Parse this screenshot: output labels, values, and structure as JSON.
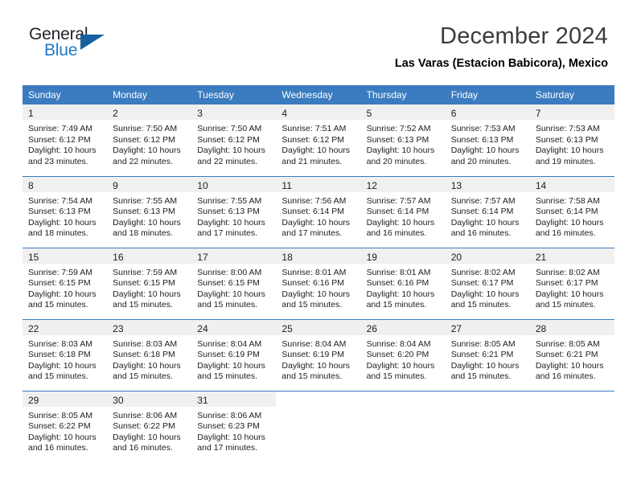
{
  "brand": {
    "name_top": "General",
    "name_bottom": "Blue",
    "triangle_color": "#17609f",
    "blue_color": "#1f7ac4"
  },
  "header": {
    "month_title": "December 2024",
    "location": "Las Varas (Estacion Babicora), Mexico"
  },
  "theme": {
    "header_blue": "#3a7cbf",
    "daynum_bg": "#f0f0f0",
    "text": "#1d1d1d"
  },
  "weekday_headers": [
    "Sunday",
    "Monday",
    "Tuesday",
    "Wednesday",
    "Thursday",
    "Friday",
    "Saturday"
  ],
  "weeks": [
    [
      {
        "day": "1",
        "details": "Sunrise: 7:49 AM\nSunset: 6:12 PM\nDaylight: 10 hours\nand 23 minutes."
      },
      {
        "day": "2",
        "details": "Sunrise: 7:50 AM\nSunset: 6:12 PM\nDaylight: 10 hours\nand 22 minutes."
      },
      {
        "day": "3",
        "details": "Sunrise: 7:50 AM\nSunset: 6:12 PM\nDaylight: 10 hours\nand 22 minutes."
      },
      {
        "day": "4",
        "details": "Sunrise: 7:51 AM\nSunset: 6:12 PM\nDaylight: 10 hours\nand 21 minutes."
      },
      {
        "day": "5",
        "details": "Sunrise: 7:52 AM\nSunset: 6:13 PM\nDaylight: 10 hours\nand 20 minutes."
      },
      {
        "day": "6",
        "details": "Sunrise: 7:53 AM\nSunset: 6:13 PM\nDaylight: 10 hours\nand 20 minutes."
      },
      {
        "day": "7",
        "details": "Sunrise: 7:53 AM\nSunset: 6:13 PM\nDaylight: 10 hours\nand 19 minutes."
      }
    ],
    [
      {
        "day": "8",
        "details": "Sunrise: 7:54 AM\nSunset: 6:13 PM\nDaylight: 10 hours\nand 18 minutes."
      },
      {
        "day": "9",
        "details": "Sunrise: 7:55 AM\nSunset: 6:13 PM\nDaylight: 10 hours\nand 18 minutes."
      },
      {
        "day": "10",
        "details": "Sunrise: 7:55 AM\nSunset: 6:13 PM\nDaylight: 10 hours\nand 17 minutes."
      },
      {
        "day": "11",
        "details": "Sunrise: 7:56 AM\nSunset: 6:14 PM\nDaylight: 10 hours\nand 17 minutes."
      },
      {
        "day": "12",
        "details": "Sunrise: 7:57 AM\nSunset: 6:14 PM\nDaylight: 10 hours\nand 16 minutes."
      },
      {
        "day": "13",
        "details": "Sunrise: 7:57 AM\nSunset: 6:14 PM\nDaylight: 10 hours\nand 16 minutes."
      },
      {
        "day": "14",
        "details": "Sunrise: 7:58 AM\nSunset: 6:14 PM\nDaylight: 10 hours\nand 16 minutes."
      }
    ],
    [
      {
        "day": "15",
        "details": "Sunrise: 7:59 AM\nSunset: 6:15 PM\nDaylight: 10 hours\nand 15 minutes."
      },
      {
        "day": "16",
        "details": "Sunrise: 7:59 AM\nSunset: 6:15 PM\nDaylight: 10 hours\nand 15 minutes."
      },
      {
        "day": "17",
        "details": "Sunrise: 8:00 AM\nSunset: 6:15 PM\nDaylight: 10 hours\nand 15 minutes."
      },
      {
        "day": "18",
        "details": "Sunrise: 8:01 AM\nSunset: 6:16 PM\nDaylight: 10 hours\nand 15 minutes."
      },
      {
        "day": "19",
        "details": "Sunrise: 8:01 AM\nSunset: 6:16 PM\nDaylight: 10 hours\nand 15 minutes."
      },
      {
        "day": "20",
        "details": "Sunrise: 8:02 AM\nSunset: 6:17 PM\nDaylight: 10 hours\nand 15 minutes."
      },
      {
        "day": "21",
        "details": "Sunrise: 8:02 AM\nSunset: 6:17 PM\nDaylight: 10 hours\nand 15 minutes."
      }
    ],
    [
      {
        "day": "22",
        "details": "Sunrise: 8:03 AM\nSunset: 6:18 PM\nDaylight: 10 hours\nand 15 minutes."
      },
      {
        "day": "23",
        "details": "Sunrise: 8:03 AM\nSunset: 6:18 PM\nDaylight: 10 hours\nand 15 minutes."
      },
      {
        "day": "24",
        "details": "Sunrise: 8:04 AM\nSunset: 6:19 PM\nDaylight: 10 hours\nand 15 minutes."
      },
      {
        "day": "25",
        "details": "Sunrise: 8:04 AM\nSunset: 6:19 PM\nDaylight: 10 hours\nand 15 minutes."
      },
      {
        "day": "26",
        "details": "Sunrise: 8:04 AM\nSunset: 6:20 PM\nDaylight: 10 hours\nand 15 minutes."
      },
      {
        "day": "27",
        "details": "Sunrise: 8:05 AM\nSunset: 6:21 PM\nDaylight: 10 hours\nand 15 minutes."
      },
      {
        "day": "28",
        "details": "Sunrise: 8:05 AM\nSunset: 6:21 PM\nDaylight: 10 hours\nand 16 minutes."
      }
    ],
    [
      {
        "day": "29",
        "details": "Sunrise: 8:05 AM\nSunset: 6:22 PM\nDaylight: 10 hours\nand 16 minutes."
      },
      {
        "day": "30",
        "details": "Sunrise: 8:06 AM\nSunset: 6:22 PM\nDaylight: 10 hours\nand 16 minutes."
      },
      {
        "day": "31",
        "details": "Sunrise: 8:06 AM\nSunset: 6:23 PM\nDaylight: 10 hours\nand 17 minutes."
      },
      {
        "day": "",
        "details": ""
      },
      {
        "day": "",
        "details": ""
      },
      {
        "day": "",
        "details": ""
      },
      {
        "day": "",
        "details": ""
      }
    ]
  ]
}
